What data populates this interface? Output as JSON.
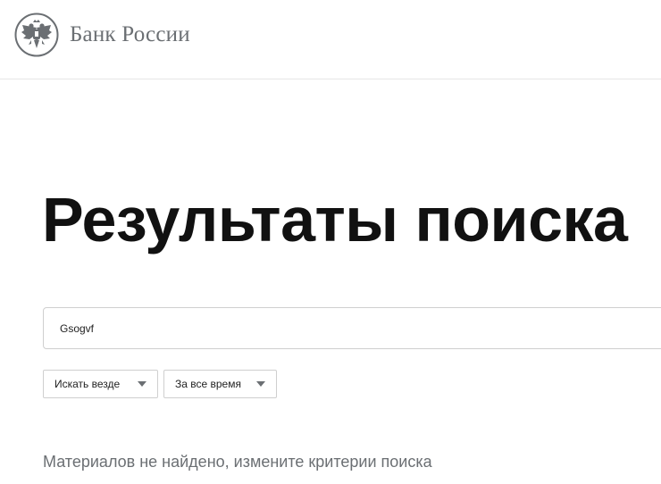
{
  "header": {
    "logo_text": "Банк России",
    "logo_icon": "double-headed-eagle-emblem"
  },
  "main": {
    "title": "Результаты поиска",
    "search": {
      "value": "Gsogvf"
    },
    "filters": {
      "scope_label": "Искать везде",
      "period_label": "За все время"
    },
    "no_results_text": "Материалов не найдено, измените критерии поиска"
  },
  "colors": {
    "text_primary": "#111111",
    "text_muted": "#6b6f73",
    "border": "#cfcfcf"
  }
}
